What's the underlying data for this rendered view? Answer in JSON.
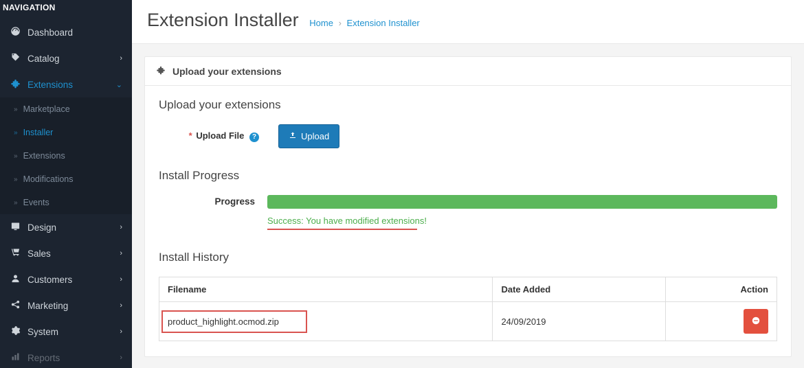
{
  "sidebar": {
    "header": "NAVIGATION",
    "items": [
      {
        "label": "Dashboard"
      },
      {
        "label": "Catalog"
      },
      {
        "label": "Extensions"
      },
      {
        "label": "Design"
      },
      {
        "label": "Sales"
      },
      {
        "label": "Customers"
      },
      {
        "label": "Marketing"
      },
      {
        "label": "System"
      },
      {
        "label": "Reports"
      }
    ],
    "extensions_sub": [
      {
        "label": "Marketplace"
      },
      {
        "label": "Installer"
      },
      {
        "label": "Extensions"
      },
      {
        "label": "Modifications"
      },
      {
        "label": "Events"
      }
    ]
  },
  "header": {
    "title": "Extension Installer",
    "breadcrumb_home": "Home",
    "breadcrumb_current": "Extension Installer"
  },
  "panel": {
    "header": "Upload your extensions",
    "upload_section_title": "Upload your extensions",
    "upload_label": "Upload File",
    "upload_button": "Upload",
    "progress_section_title": "Install Progress",
    "progress_label": "Progress",
    "progress_message": "Success: You have modified extensions!",
    "history_section_title": "Install History",
    "table": {
      "col_filename": "Filename",
      "col_date": "Date Added",
      "col_action": "Action",
      "rows": [
        {
          "filename": "product_highlight.ocmod.zip",
          "date": "24/09/2019"
        }
      ]
    }
  }
}
